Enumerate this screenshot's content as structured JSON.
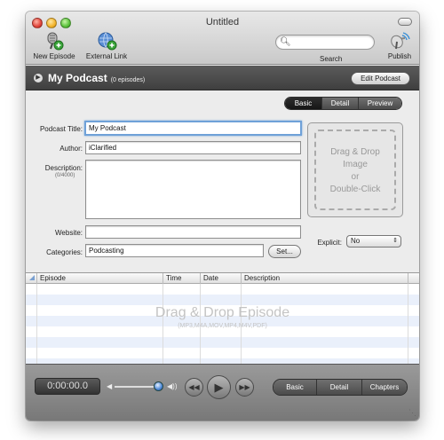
{
  "window": {
    "title": "Untitled"
  },
  "toolbar": {
    "new_episode_label": "New Episode",
    "external_link_label": "External Link",
    "search_label": "Search",
    "search_placeholder": "",
    "publish_label": "Publish"
  },
  "header": {
    "podcast_title": "My Podcast",
    "episode_count": "(0 episodes)",
    "edit_button_label": "Edit Podcast"
  },
  "view_tabs": [
    {
      "label": "Basic",
      "active": true
    },
    {
      "label": "Detail",
      "active": false
    },
    {
      "label": "Preview",
      "active": false
    }
  ],
  "form": {
    "title_label": "Podcast Title:",
    "title_value": "My Podcast",
    "author_label": "Author:",
    "author_value": "iClarified",
    "description_label": "Description:",
    "description_counter": "(0/4000)",
    "description_value": "",
    "website_label": "Website:",
    "website_value": "",
    "categories_label": "Categories:",
    "categories_value": "Podcasting",
    "set_button_label": "Set...",
    "explicit_label": "Explicit:",
    "explicit_value": "No"
  },
  "artwork": {
    "line1": "Drag & Drop",
    "line2": "Image",
    "line3": "or",
    "line4": "Double-Click"
  },
  "episode_table": {
    "columns": [
      "Episode",
      "Time",
      "Date",
      "Description"
    ],
    "rows": [],
    "drop_title": "Drag & Drop Episode",
    "drop_formats": "(MP3,M4A,MOV,MP4,M4V,PDF)"
  },
  "player": {
    "timecode": "0:00:00.0",
    "volume": 0.9
  },
  "bottom_tabs": [
    {
      "label": "Basic"
    },
    {
      "label": "Detail"
    },
    {
      "label": "Chapters"
    }
  ],
  "colors": {
    "header_bg": "#4a4a4a",
    "focus_ring": "#6fa1d8",
    "table_stripe": "#eaf0fb",
    "slider_knob": "#4a86d6"
  }
}
